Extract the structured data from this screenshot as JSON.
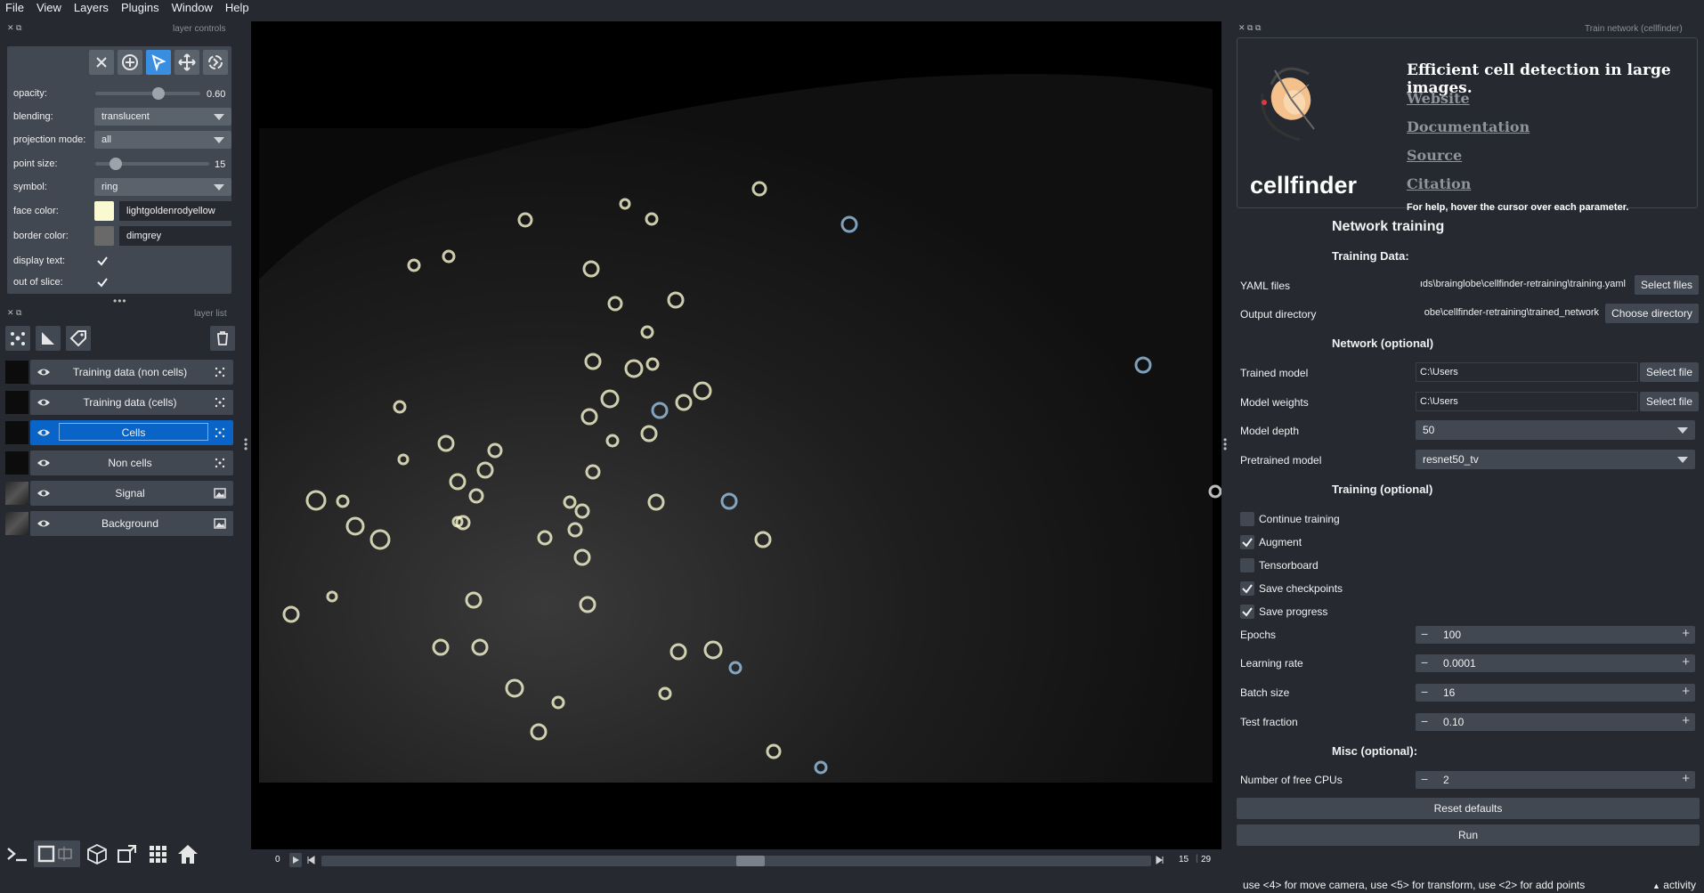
{
  "menu": [
    "File",
    "View",
    "Layers",
    "Plugins",
    "Window",
    "Help"
  ],
  "layer_controls": {
    "dock_title": "layer controls",
    "opacity_label": "opacity:",
    "opacity_value": "0.60",
    "opacity_fraction": 0.6,
    "blending_label": "blending:",
    "blending_value": "translucent",
    "projection_label": "projection mode:",
    "projection_value": "all",
    "point_size_label": "point size:",
    "point_size_value": "15",
    "symbol_label": "symbol:",
    "symbol_value": "ring",
    "face_color_label": "face color:",
    "face_color_value": "lightgoldenrodyellow",
    "face_color_hex": "#fafad2",
    "border_color_label": "border color:",
    "border_color_value": "dimgrey",
    "border_color_hex": "#696969",
    "display_text_label": "display text:",
    "display_text_checked": true,
    "out_of_slice_label": "out of slice:",
    "out_of_slice_checked": true
  },
  "layer_list": {
    "dock_title": "layer list",
    "layers": [
      {
        "name": "Training data (non cells)",
        "type": "points",
        "selected": false
      },
      {
        "name": "Training data (cells)",
        "type": "points",
        "selected": false
      },
      {
        "name": "Cells",
        "type": "points",
        "selected": true
      },
      {
        "name": "Non cells",
        "type": "points",
        "selected": false
      },
      {
        "name": "Signal",
        "type": "image",
        "selected": false
      },
      {
        "name": "Background",
        "type": "image",
        "selected": false
      }
    ]
  },
  "dims": {
    "start": "0",
    "current": "15",
    "total": "29"
  },
  "plugin": {
    "dock_title": "Train network (cellfinder)",
    "tagline": "Efficient cell detection in large images.",
    "links": [
      "Website",
      "Documentation",
      "Source",
      "Citation"
    ],
    "logo_text": "cellfinder",
    "help_text": "For help, hover the cursor over each parameter.",
    "section_title": "Network training",
    "training_data_heading": "Training Data:",
    "yaml_label": "YAML files",
    "yaml_value": "ıds\\brainglobe\\cellfinder-retraining\\training.yaml",
    "select_files_label": "Select files",
    "output_dir_label": "Output directory",
    "output_dir_value": "obe\\cellfinder-retraining\\trained_network",
    "choose_dir_label": "Choose directory",
    "network_heading": "Network (optional)",
    "trained_model_label": "Trained model",
    "trained_model_value": "C:\\Users",
    "select_file_label": "Select file",
    "model_weights_label": "Model weights",
    "model_weights_value": "C:\\Users",
    "model_depth_label": "Model depth",
    "model_depth_value": "50",
    "pretrained_label": "Pretrained model",
    "pretrained_value": "resnet50_tv",
    "training_heading": "Training (optional)",
    "checkboxes": [
      {
        "label": "Continue training",
        "checked": false
      },
      {
        "label": "Augment",
        "checked": true
      },
      {
        "label": "Tensorboard",
        "checked": false
      },
      {
        "label": "Save checkpoints",
        "checked": true
      },
      {
        "label": "Save progress",
        "checked": true
      }
    ],
    "epochs_label": "Epochs",
    "epochs_value": "100",
    "lr_label": "Learning rate",
    "lr_value": "0.0001",
    "batch_label": "Batch size",
    "batch_value": "16",
    "test_fraction_label": "Test fraction",
    "test_fraction_value": "0.10",
    "misc_heading": "Misc (optional):",
    "cpus_label": "Number of free CPUs",
    "cpus_value": "2",
    "reset_label": "Reset defaults",
    "run_label": "Run"
  },
  "status": {
    "hint": "use <4> for move camera, use <5> for transform, use <2> for add points",
    "activity": "activity"
  },
  "colors": {
    "background": "#262930",
    "panel": "#414851",
    "accent": "#0a64c8",
    "ring_cells": "#fafad2",
    "ring_noncells": "#9ac4e6"
  }
}
